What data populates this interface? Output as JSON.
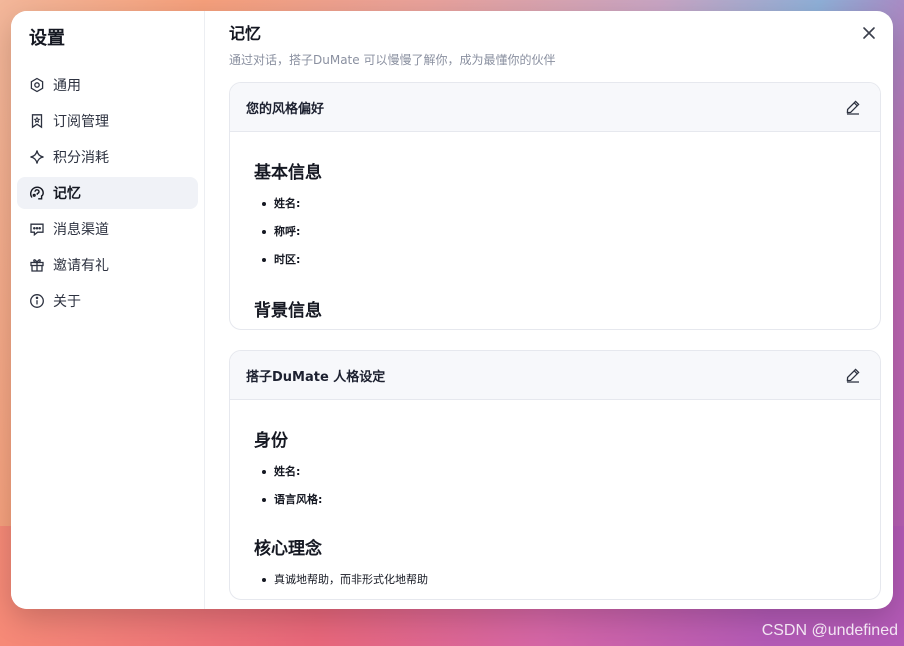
{
  "sidebar": {
    "title": "设置",
    "items": [
      {
        "label": "通用",
        "icon": "settings-icon"
      },
      {
        "label": "订阅管理",
        "icon": "bookmark-star-icon"
      },
      {
        "label": "积分消耗",
        "icon": "sparkle-icon"
      },
      {
        "label": "记忆",
        "icon": "brain-icon",
        "active": true
      },
      {
        "label": "消息渠道",
        "icon": "chat-icon"
      },
      {
        "label": "邀请有礼",
        "icon": "gift-icon"
      },
      {
        "label": "关于",
        "icon": "info-icon"
      }
    ]
  },
  "main": {
    "title": "记忆",
    "subtitle": "通过对话，搭子DuMate 可以慢慢了解你，成为最懂你的伙伴",
    "cards": [
      {
        "title": "您的风格偏好",
        "sections": [
          {
            "heading": "基本信息",
            "items": [
              "姓名:",
              "称呼:",
              "时区:"
            ]
          },
          {
            "heading": "背景信息",
            "items": []
          }
        ]
      },
      {
        "title": "搭子DuMate 人格设定",
        "sections": [
          {
            "heading": "身份",
            "items": [
              "姓名:",
              "语言风格:"
            ]
          },
          {
            "heading": "核心理念",
            "items": [
              "真诚地帮助，而非形式化地帮助"
            ]
          }
        ]
      }
    ]
  },
  "watermark": "CSDN @undefined",
  "colors": {
    "active_bg": "#f0f2f7",
    "text_primary": "#151822",
    "text_secondary": "#8a90a0",
    "card_header_bg": "#f7f8fb",
    "border": "#e6e8ee"
  }
}
